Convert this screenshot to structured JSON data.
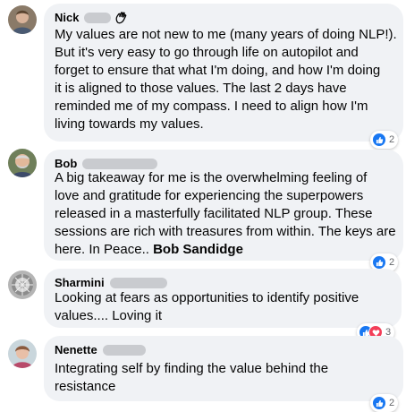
{
  "comments": [
    {
      "author": "Nick",
      "lines": [
        "My values are not new to me (many years of doing NLP!).",
        "But it's very easy to go through life on autopilot and",
        "forget to ensure that what I'm doing, and how I'm doing",
        "it is aligned to those values. The last 2 days have",
        "reminded me of my compass. I need to align how I'm",
        "living towards my values."
      ],
      "reaction_count": "2",
      "reactions": [
        "like"
      ]
    },
    {
      "author": "Bob",
      "lines": [
        "A big takeaway for me is the overwhelming feeling of",
        "love and gratitude for experiencing the superpowers",
        "released in a masterfully facilitated NLP group. These",
        "sessions are rich with treasures from within. The keys are",
        "here. In Peace.."
      ],
      "signature": "Bob Sandidge",
      "reaction_count": "2",
      "reactions": [
        "like"
      ]
    },
    {
      "author": "Sharmini",
      "lines": [
        "Looking at fears as opportunities to identify positive",
        "values.... Loving it"
      ],
      "reaction_count": "3",
      "reactions": [
        "like",
        "love"
      ]
    },
    {
      "author": "Nenette",
      "lines": [
        "Integrating self by finding the value behind the",
        "resistance"
      ],
      "reaction_count": "2",
      "reactions": [
        "like"
      ]
    }
  ],
  "colors": {
    "bubble": "#f0f2f5",
    "like": "#1877f2",
    "love": "#f33e58"
  },
  "icons": {
    "wave": "waving-hand-icon",
    "like": "thumbs-up-icon",
    "love": "heart-icon"
  }
}
